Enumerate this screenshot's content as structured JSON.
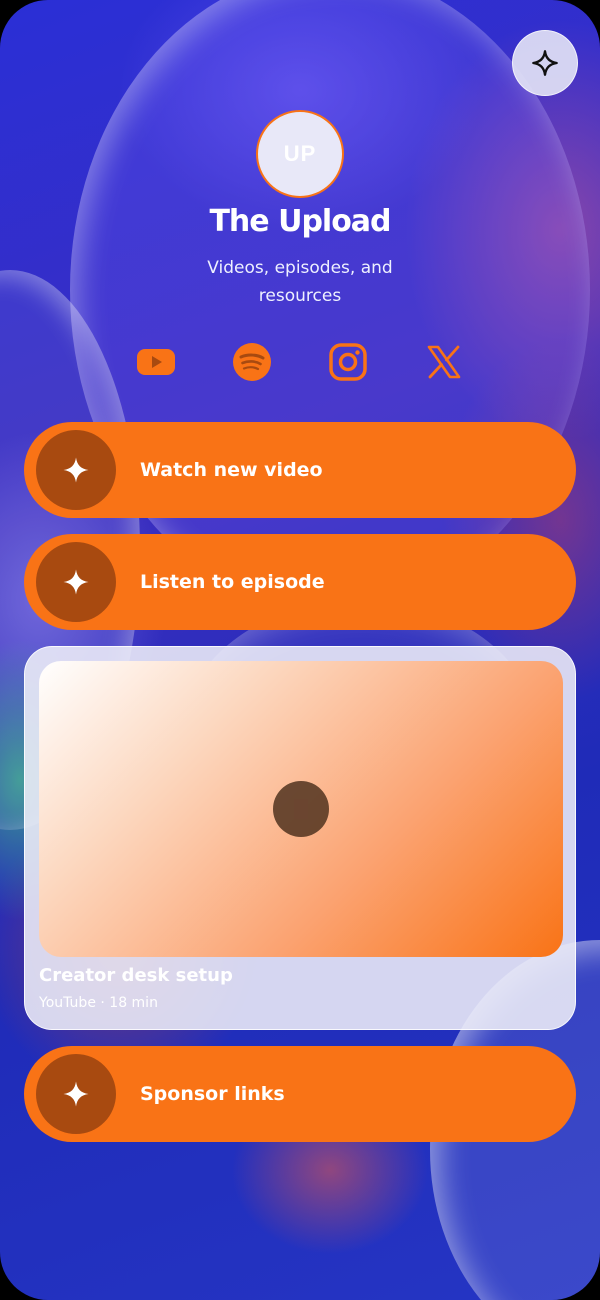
{
  "profile": {
    "avatar_initials": "UP",
    "name": "The Upload",
    "bio": "Videos, episodes, and resources"
  },
  "header": {
    "action_icon": "sparkle-icon"
  },
  "socials": [
    {
      "name": "YouTube",
      "icon": "youtube-icon"
    },
    {
      "name": "Spotify",
      "icon": "spotify-icon"
    },
    {
      "name": "Instagram",
      "icon": "instagram-icon"
    },
    {
      "name": "X",
      "icon": "x-icon"
    }
  ],
  "links": [
    {
      "label": "Watch new video",
      "icon": "sparkle-icon"
    },
    {
      "label": "Listen to episode",
      "icon": "sparkle-icon"
    },
    {
      "label": "Sponsor links",
      "icon": "sparkle-icon"
    }
  ],
  "media_card": {
    "title": "Creator desk setup",
    "meta": "YouTube · 18 min",
    "play_icon": "play-icon"
  },
  "colors": {
    "accent": "#f97316",
    "accent_dark": "#a84a10",
    "background": "#2a2fd6"
  }
}
